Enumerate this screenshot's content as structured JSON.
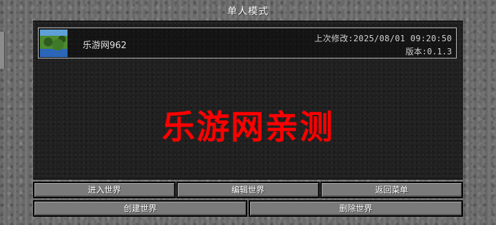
{
  "screen": {
    "title": "单人模式"
  },
  "worlds": [
    {
      "name": "乐游网962",
      "last_modified": "上次修改:2025/08/01 09:20:50",
      "version": "版本:0.1.3"
    }
  ],
  "watermark": "乐游网亲测",
  "buttons": {
    "enter_world": "进入世界",
    "edit_world": "编辑世界",
    "back_menu": "返回菜单",
    "create_world": "创建世界",
    "delete_world": "删除世界"
  }
}
